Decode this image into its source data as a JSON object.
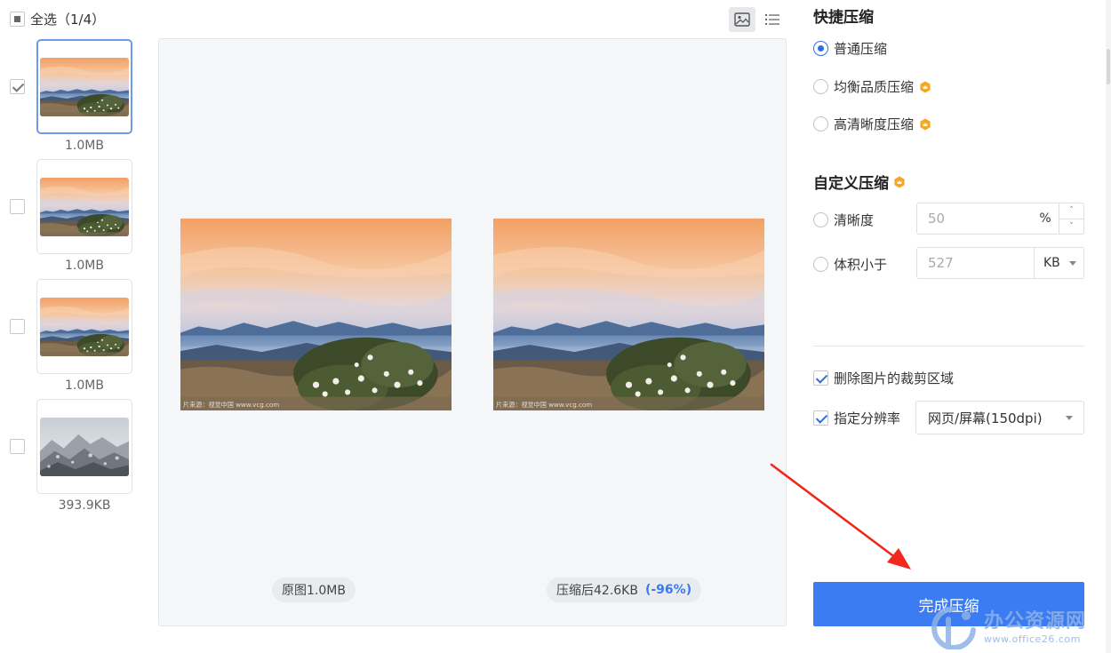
{
  "header": {
    "select_all_label": "全选（1/4）"
  },
  "view_toggle": {
    "active": "image-view",
    "icons": [
      "image-view-icon",
      "list-view-icon"
    ]
  },
  "thumbnails": [
    {
      "size": "1.0MB",
      "checked": true,
      "selected": true,
      "scene": "sunset"
    },
    {
      "size": "1.0MB",
      "checked": false,
      "selected": false,
      "scene": "sunset"
    },
    {
      "size": "1.0MB",
      "checked": false,
      "selected": false,
      "scene": "sunset"
    },
    {
      "size": "393.9KB",
      "checked": false,
      "selected": false,
      "scene": "snow"
    }
  ],
  "preview": {
    "original_label": "原图1.0MB",
    "compressed_label": "压缩后42.6KB",
    "compressed_percent": "(-96%)",
    "photo_watermark": "片来源：视觉中国 www.vcg.com"
  },
  "quick_compress": {
    "title": "快捷压缩",
    "options": [
      {
        "label": "普通压缩",
        "selected": true,
        "vip": false
      },
      {
        "label": "均衡品质压缩",
        "selected": false,
        "vip": true
      },
      {
        "label": "高清晰度压缩",
        "selected": false,
        "vip": true
      }
    ]
  },
  "custom_compress": {
    "title": "自定义压缩",
    "clarity": {
      "label": "清晰度",
      "placeholder": "50",
      "unit": "%"
    },
    "size_limit": {
      "label": "体积小于",
      "placeholder": "527",
      "unit": "KB"
    }
  },
  "options": {
    "remove_crop": {
      "label": "删除图片的裁剪区域",
      "checked": true
    },
    "resolution": {
      "label": "指定分辨率",
      "checked": true,
      "value": "网页/屏幕(150dpi)"
    }
  },
  "actions": {
    "done_label": "完成压缩"
  },
  "watermark": {
    "main": "办公资源网",
    "sub": "www.office26.com"
  },
  "colors": {
    "accent": "#3b7cf3",
    "vip_badge": "#f5a623",
    "annotation_arrow": "#f0281e"
  }
}
